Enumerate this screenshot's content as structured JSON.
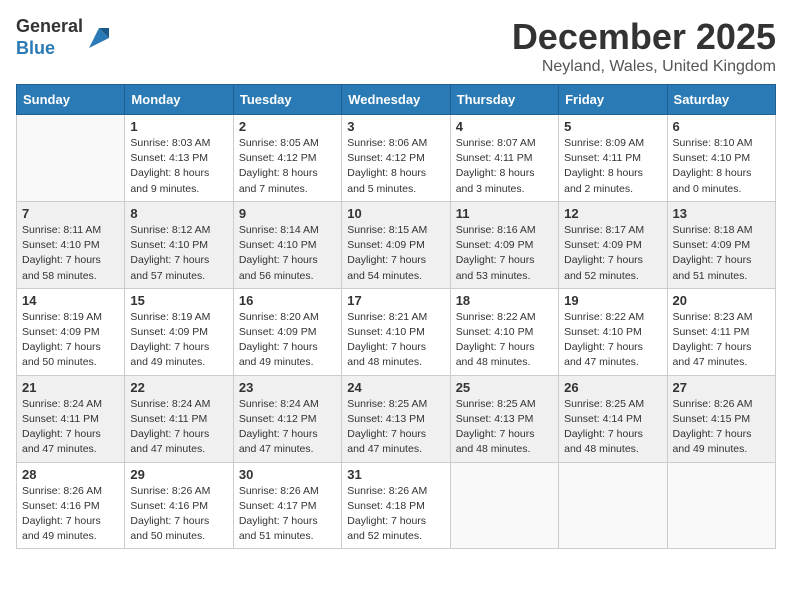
{
  "header": {
    "logo_general": "General",
    "logo_blue": "Blue",
    "month_title": "December 2025",
    "location": "Neyland, Wales, United Kingdom"
  },
  "weekdays": [
    "Sunday",
    "Monday",
    "Tuesday",
    "Wednesday",
    "Thursday",
    "Friday",
    "Saturday"
  ],
  "weeks": [
    [
      {
        "day": "",
        "sunrise": "",
        "sunset": "",
        "daylight": ""
      },
      {
        "day": "1",
        "sunrise": "Sunrise: 8:03 AM",
        "sunset": "Sunset: 4:13 PM",
        "daylight": "Daylight: 8 hours and 9 minutes."
      },
      {
        "day": "2",
        "sunrise": "Sunrise: 8:05 AM",
        "sunset": "Sunset: 4:12 PM",
        "daylight": "Daylight: 8 hours and 7 minutes."
      },
      {
        "day": "3",
        "sunrise": "Sunrise: 8:06 AM",
        "sunset": "Sunset: 4:12 PM",
        "daylight": "Daylight: 8 hours and 5 minutes."
      },
      {
        "day": "4",
        "sunrise": "Sunrise: 8:07 AM",
        "sunset": "Sunset: 4:11 PM",
        "daylight": "Daylight: 8 hours and 3 minutes."
      },
      {
        "day": "5",
        "sunrise": "Sunrise: 8:09 AM",
        "sunset": "Sunset: 4:11 PM",
        "daylight": "Daylight: 8 hours and 2 minutes."
      },
      {
        "day": "6",
        "sunrise": "Sunrise: 8:10 AM",
        "sunset": "Sunset: 4:10 PM",
        "daylight": "Daylight: 8 hours and 0 minutes."
      }
    ],
    [
      {
        "day": "7",
        "sunrise": "Sunrise: 8:11 AM",
        "sunset": "Sunset: 4:10 PM",
        "daylight": "Daylight: 7 hours and 58 minutes."
      },
      {
        "day": "8",
        "sunrise": "Sunrise: 8:12 AM",
        "sunset": "Sunset: 4:10 PM",
        "daylight": "Daylight: 7 hours and 57 minutes."
      },
      {
        "day": "9",
        "sunrise": "Sunrise: 8:14 AM",
        "sunset": "Sunset: 4:10 PM",
        "daylight": "Daylight: 7 hours and 56 minutes."
      },
      {
        "day": "10",
        "sunrise": "Sunrise: 8:15 AM",
        "sunset": "Sunset: 4:09 PM",
        "daylight": "Daylight: 7 hours and 54 minutes."
      },
      {
        "day": "11",
        "sunrise": "Sunrise: 8:16 AM",
        "sunset": "Sunset: 4:09 PM",
        "daylight": "Daylight: 7 hours and 53 minutes."
      },
      {
        "day": "12",
        "sunrise": "Sunrise: 8:17 AM",
        "sunset": "Sunset: 4:09 PM",
        "daylight": "Daylight: 7 hours and 52 minutes."
      },
      {
        "day": "13",
        "sunrise": "Sunrise: 8:18 AM",
        "sunset": "Sunset: 4:09 PM",
        "daylight": "Daylight: 7 hours and 51 minutes."
      }
    ],
    [
      {
        "day": "14",
        "sunrise": "Sunrise: 8:19 AM",
        "sunset": "Sunset: 4:09 PM",
        "daylight": "Daylight: 7 hours and 50 minutes."
      },
      {
        "day": "15",
        "sunrise": "Sunrise: 8:19 AM",
        "sunset": "Sunset: 4:09 PM",
        "daylight": "Daylight: 7 hours and 49 minutes."
      },
      {
        "day": "16",
        "sunrise": "Sunrise: 8:20 AM",
        "sunset": "Sunset: 4:09 PM",
        "daylight": "Daylight: 7 hours and 49 minutes."
      },
      {
        "day": "17",
        "sunrise": "Sunrise: 8:21 AM",
        "sunset": "Sunset: 4:10 PM",
        "daylight": "Daylight: 7 hours and 48 minutes."
      },
      {
        "day": "18",
        "sunrise": "Sunrise: 8:22 AM",
        "sunset": "Sunset: 4:10 PM",
        "daylight": "Daylight: 7 hours and 48 minutes."
      },
      {
        "day": "19",
        "sunrise": "Sunrise: 8:22 AM",
        "sunset": "Sunset: 4:10 PM",
        "daylight": "Daylight: 7 hours and 47 minutes."
      },
      {
        "day": "20",
        "sunrise": "Sunrise: 8:23 AM",
        "sunset": "Sunset: 4:11 PM",
        "daylight": "Daylight: 7 hours and 47 minutes."
      }
    ],
    [
      {
        "day": "21",
        "sunrise": "Sunrise: 8:24 AM",
        "sunset": "Sunset: 4:11 PM",
        "daylight": "Daylight: 7 hours and 47 minutes."
      },
      {
        "day": "22",
        "sunrise": "Sunrise: 8:24 AM",
        "sunset": "Sunset: 4:11 PM",
        "daylight": "Daylight: 7 hours and 47 minutes."
      },
      {
        "day": "23",
        "sunrise": "Sunrise: 8:24 AM",
        "sunset": "Sunset: 4:12 PM",
        "daylight": "Daylight: 7 hours and 47 minutes."
      },
      {
        "day": "24",
        "sunrise": "Sunrise: 8:25 AM",
        "sunset": "Sunset: 4:13 PM",
        "daylight": "Daylight: 7 hours and 47 minutes."
      },
      {
        "day": "25",
        "sunrise": "Sunrise: 8:25 AM",
        "sunset": "Sunset: 4:13 PM",
        "daylight": "Daylight: 7 hours and 48 minutes."
      },
      {
        "day": "26",
        "sunrise": "Sunrise: 8:25 AM",
        "sunset": "Sunset: 4:14 PM",
        "daylight": "Daylight: 7 hours and 48 minutes."
      },
      {
        "day": "27",
        "sunrise": "Sunrise: 8:26 AM",
        "sunset": "Sunset: 4:15 PM",
        "daylight": "Daylight: 7 hours and 49 minutes."
      }
    ],
    [
      {
        "day": "28",
        "sunrise": "Sunrise: 8:26 AM",
        "sunset": "Sunset: 4:16 PM",
        "daylight": "Daylight: 7 hours and 49 minutes."
      },
      {
        "day": "29",
        "sunrise": "Sunrise: 8:26 AM",
        "sunset": "Sunset: 4:16 PM",
        "daylight": "Daylight: 7 hours and 50 minutes."
      },
      {
        "day": "30",
        "sunrise": "Sunrise: 8:26 AM",
        "sunset": "Sunset: 4:17 PM",
        "daylight": "Daylight: 7 hours and 51 minutes."
      },
      {
        "day": "31",
        "sunrise": "Sunrise: 8:26 AM",
        "sunset": "Sunset: 4:18 PM",
        "daylight": "Daylight: 7 hours and 52 minutes."
      },
      {
        "day": "",
        "sunrise": "",
        "sunset": "",
        "daylight": ""
      },
      {
        "day": "",
        "sunrise": "",
        "sunset": "",
        "daylight": ""
      },
      {
        "day": "",
        "sunrise": "",
        "sunset": "",
        "daylight": ""
      }
    ]
  ]
}
